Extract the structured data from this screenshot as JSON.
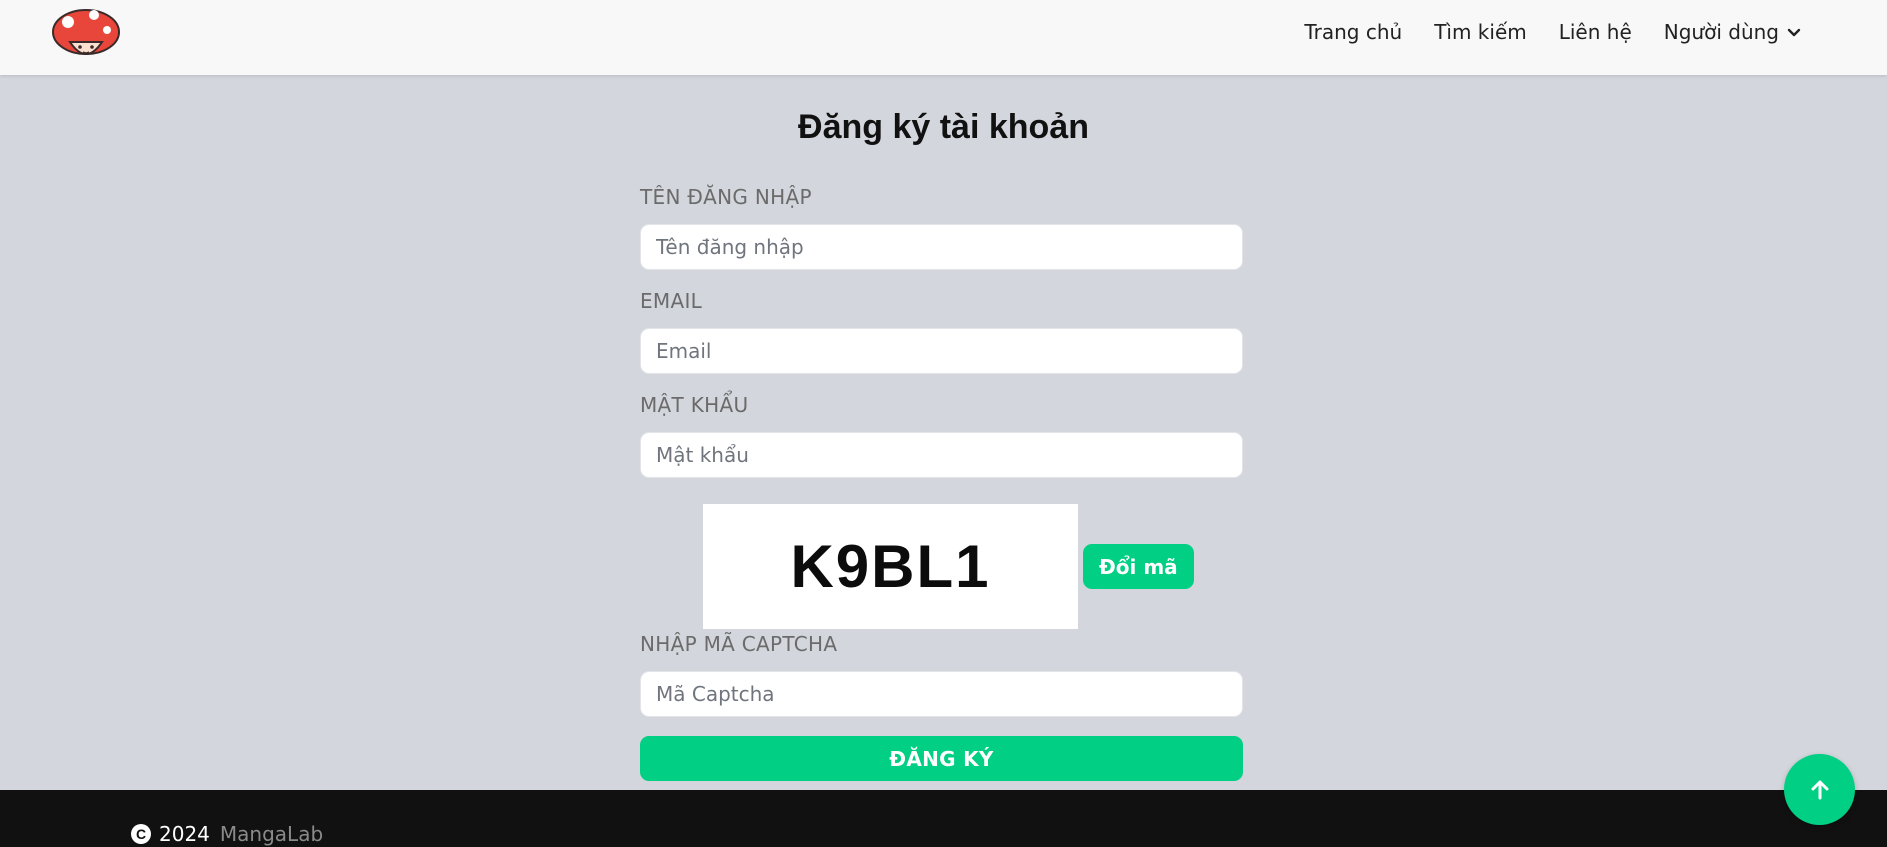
{
  "header": {
    "logo_icon": "mushroom-mascot-icon",
    "nav": [
      {
        "label": "Trang chủ"
      },
      {
        "label": "Tìm kiếm"
      },
      {
        "label": "Liên hệ"
      },
      {
        "label": "Người dùng",
        "icon": "chevron-down-icon"
      }
    ]
  },
  "form": {
    "title": "Đăng ký tài khoản",
    "username": {
      "label": "TÊN ĐĂNG NHẬP",
      "placeholder": "Tên đăng nhập",
      "value": ""
    },
    "email": {
      "label": "EMAIL",
      "placeholder": "Email",
      "value": ""
    },
    "password": {
      "label": "MẬT KHẨU",
      "placeholder": "Mật khẩu",
      "value": ""
    },
    "captcha": {
      "code": "K9BL1",
      "refresh_label": "Đổi mã",
      "label": "NHẬP MÃ CAPTCHA",
      "placeholder": "Mã Captcha",
      "value": ""
    },
    "submit_label": "ĐĂNG KÝ"
  },
  "footer": {
    "copyright_icon": "copyright-icon",
    "year": "2024",
    "brand": "MangaLab"
  },
  "scroll_top_icon": "arrow-up-icon",
  "colors": {
    "accent": "#00cf84",
    "background": "#d3d6dc",
    "header": "#f8f8f8",
    "footer": "#111111"
  }
}
